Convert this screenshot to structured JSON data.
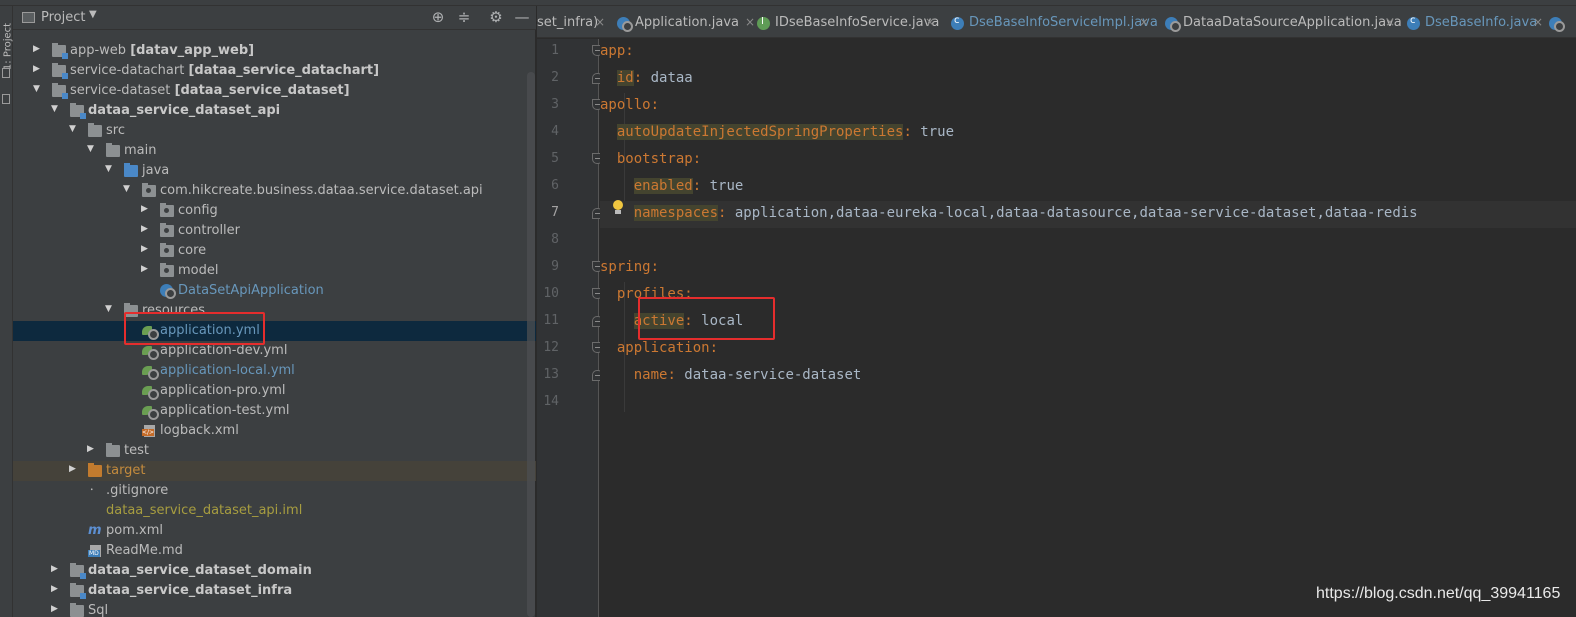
{
  "toolstrip": {
    "label": "1: Project"
  },
  "project_panel": {
    "title": "Project"
  },
  "tree": [
    {
      "label": "app-web",
      "bold": "[datav_app_web]"
    },
    {
      "label": "service-datachart",
      "bold": "[dataa_service_datachart]"
    },
    {
      "label": "service-dataset",
      "bold": "[dataa_service_dataset]"
    },
    {
      "label": "",
      "bold": "dataa_service_dataset_api"
    },
    {
      "label": "src"
    },
    {
      "label": "main"
    },
    {
      "label": "java"
    },
    {
      "label": "com.hikcreate.business.dataa.service.dataset.api"
    },
    {
      "label": "config"
    },
    {
      "label": "controller"
    },
    {
      "label": "core"
    },
    {
      "label": "model"
    },
    {
      "label": "DataSetApiApplication"
    },
    {
      "label": "resources"
    },
    {
      "label": "application.yml"
    },
    {
      "label": "application-dev.yml"
    },
    {
      "label": "application-local.yml"
    },
    {
      "label": "application-pro.yml"
    },
    {
      "label": "application-test.yml"
    },
    {
      "label": "logback.xml"
    },
    {
      "label": "test"
    },
    {
      "label": "target"
    },
    {
      "label": ".gitignore"
    },
    {
      "label": "dataa_service_dataset_api.iml"
    },
    {
      "label": "pom.xml"
    },
    {
      "label": "ReadMe.md"
    },
    {
      "label": "",
      "bold": "dataa_service_dataset_domain"
    },
    {
      "label": "",
      "bold": "dataa_service_dataset_infra"
    },
    {
      "label": "Sql"
    }
  ],
  "tabs": [
    {
      "label": "set_infra)"
    },
    {
      "label": "Application.java"
    },
    {
      "label": "IDseBaseInfoService.java"
    },
    {
      "label": "DseBaseInfoServiceImpl.java"
    },
    {
      "label": "DataaDataSourceApplication.java"
    },
    {
      "label": "DseBaseInfo.java"
    }
  ],
  "editor": {
    "line_numbers": [
      "1",
      "2",
      "3",
      "4",
      "5",
      "6",
      "7",
      "8",
      "9",
      "10",
      "11",
      "12",
      "13",
      "14"
    ],
    "lines": [
      {
        "key": "app",
        "value": ""
      },
      {
        "key": "id",
        "value": " dataa"
      },
      {
        "key": "apollo",
        "value": ""
      },
      {
        "key": "autoUpdateInjectedSpringProperties",
        "value": " true"
      },
      {
        "key": "bootstrap",
        "value": ""
      },
      {
        "key": "enabled",
        "value": " true"
      },
      {
        "key": "namespaces",
        "value": " application,dataa-eureka-local,dataa-datasource,dataa-service-dataset,dataa-redis"
      },
      {
        "key": "",
        "value": ""
      },
      {
        "key": "spring",
        "value": ""
      },
      {
        "key": "profiles",
        "value": ""
      },
      {
        "key": "active",
        "value": " local"
      },
      {
        "key": "application",
        "value": ""
      },
      {
        "key": "name",
        "value": " dataa-service-dataset"
      },
      {
        "key": "",
        "value": ""
      }
    ]
  },
  "watermark": "https://blog.csdn.net/qq_39941165",
  "colors": {
    "keyword": "#cc7832",
    "value": "#a9b7c6",
    "highlight_box": "#e52d2d",
    "selection": "#0d293e"
  }
}
